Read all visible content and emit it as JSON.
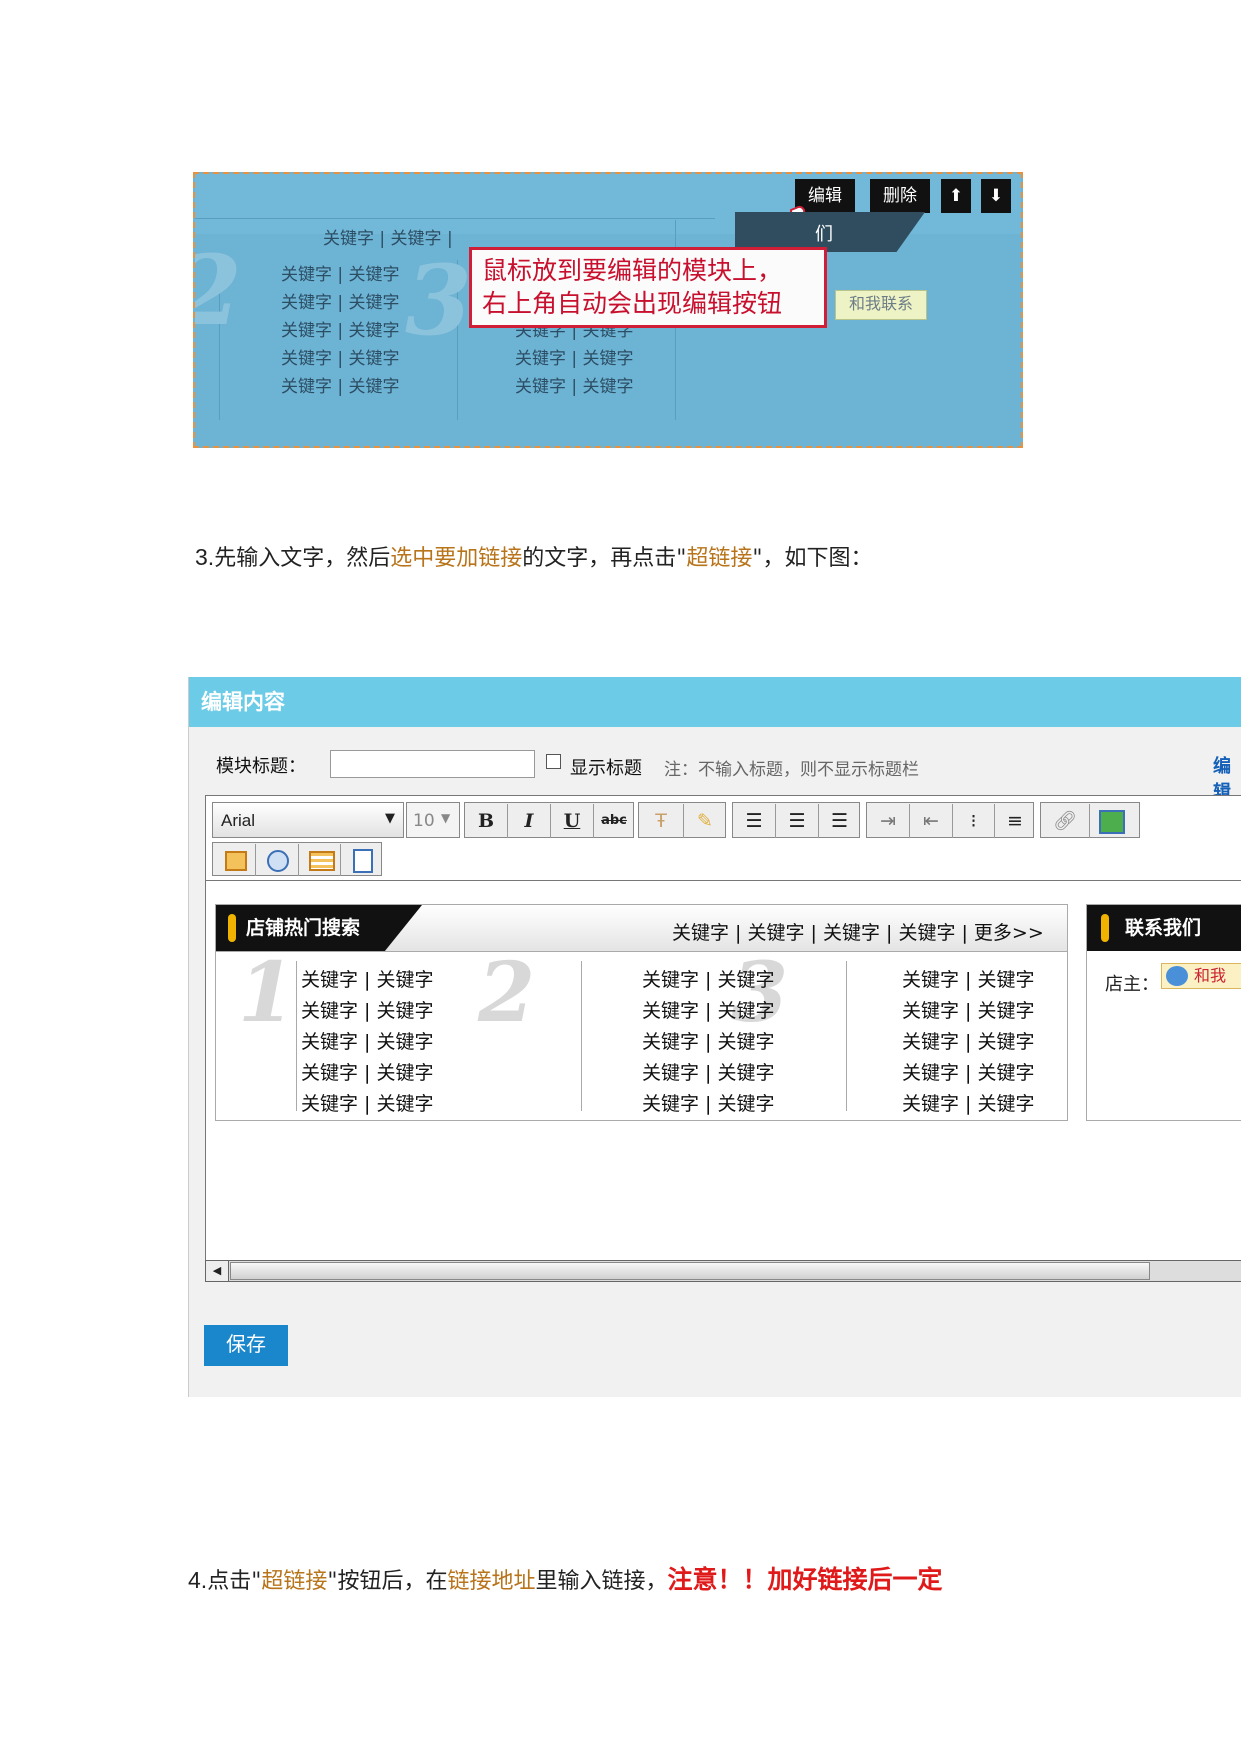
{
  "shot1": {
    "buttons": {
      "edit": "编辑",
      "delete": "删除",
      "up": "⬆",
      "down": "⬇"
    },
    "top_keywords": "关键字 | 关键字 |",
    "keywords_col1": [
      "关键字 | 关键字",
      "关键字 | 关键字",
      "关键字 | 关键字",
      "关键字 | 关键字",
      "关键字 | 关键字"
    ],
    "keywords_col2": [
      "关键字 | 关键字",
      "关键字 | 关键字",
      "关键字 | 关键字"
    ],
    "big_numbers": [
      "2",
      "3"
    ],
    "tag_text": "们",
    "callout": [
      "鼠标放到要编辑的模块上，",
      "右上角自动会出现编辑按钮"
    ],
    "contact_button": "和我联系"
  },
  "para3": {
    "num": "3.",
    "t1": "先输入文字，然后",
    "h1": "选中要加链接",
    "t2": "的文字，再点击\"",
    "h2": "超链接",
    "t3": "\"，如下图："
  },
  "shot2": {
    "header_title": "编辑内容",
    "module_title_label": "模块标题：",
    "show_title_label": "显示标题",
    "note": "注：不输入标题，则不显示标题栏",
    "right_link": "编辑",
    "font_select": "Arial",
    "size_select": "10",
    "toolbar": {
      "bold": "B",
      "italic": "I",
      "underline": "U",
      "strike": "abc"
    },
    "panel": {
      "title": "店铺热门搜索",
      "top_keywords": "关键字 | 关键字 | 关键字 | 关键字 | 更多>>",
      "big_numbers": [
        "1",
        "2",
        "3"
      ],
      "col1": [
        "关键字 | 关键字",
        "关键字 | 关键字",
        "关键字 | 关键字",
        "关键字 | 关键字",
        "关键字 | 关键字"
      ],
      "col2": [
        "关键字 | 关键字",
        "关键字 | 关键字",
        "关键字 | 关键字",
        "关键字 | 关键字",
        "关键字 | 关键字"
      ],
      "col3": [
        "关键字 | 关键字",
        "关键字 | 关键字",
        "关键字 | 关键字",
        "关键字 | 关键字",
        "关键字 | 关键字"
      ]
    },
    "contact_panel": {
      "title": "联系我们",
      "owner_label": "店主：",
      "contact_btn": "和我"
    },
    "save_button": "保存"
  },
  "para4": {
    "num": "4.",
    "t1": "点击\"",
    "h1": "超链接",
    "t2": "\"按钮后，在",
    "h2": "链接地址",
    "t3": "里输入链接，",
    "red": "注意！！加好链接后一定"
  }
}
